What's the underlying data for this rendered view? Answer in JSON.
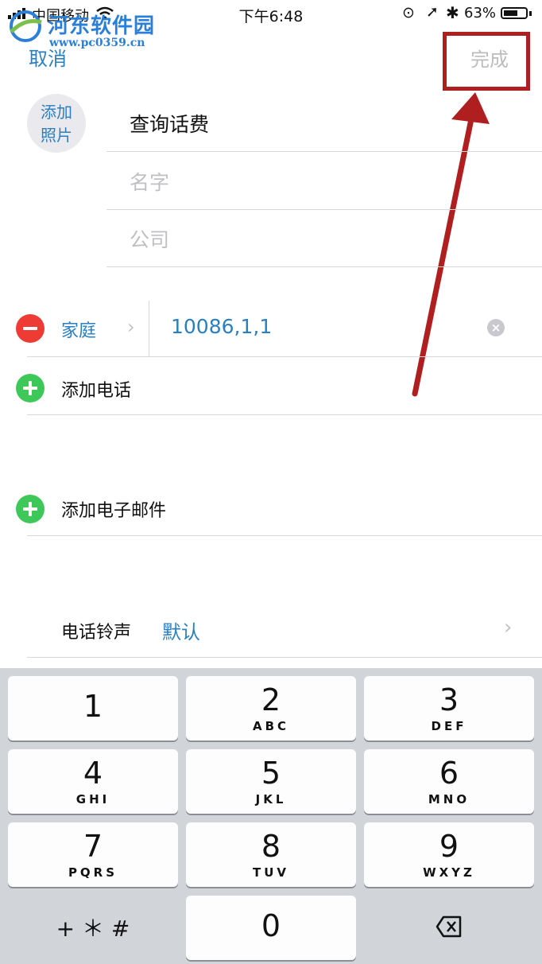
{
  "watermark": {
    "title": "河东软件园",
    "url": "www.pc0359.cn"
  },
  "status_bar": {
    "carrier": "中国移动",
    "time": "下午6:48",
    "battery": "63%"
  },
  "nav": {
    "cancel": "取消",
    "done": "完成"
  },
  "contact": {
    "photo_line1": "添加",
    "photo_line2": "照片",
    "first_field": "查询话费",
    "name_placeholder": "名字",
    "company_placeholder": "公司"
  },
  "phone": {
    "label": "家庭",
    "number": "10086,1,1"
  },
  "add_phone": "添加电话",
  "add_email": "添加电子邮件",
  "ringtone": {
    "label": "电话铃声",
    "value": "默认"
  },
  "keypad": {
    "keys": [
      {
        "num": "1",
        "letters": ""
      },
      {
        "num": "2",
        "letters": "ABC"
      },
      {
        "num": "3",
        "letters": "DEF"
      },
      {
        "num": "4",
        "letters": "GHI"
      },
      {
        "num": "5",
        "letters": "JKL"
      },
      {
        "num": "6",
        "letters": "MNO"
      },
      {
        "num": "7",
        "letters": "PQRS"
      },
      {
        "num": "8",
        "letters": "TUV"
      },
      {
        "num": "9",
        "letters": "WXYZ"
      }
    ],
    "symbols": "+ ＊ #",
    "zero": "0"
  },
  "colors": {
    "accent_blue": "#2a7fc0",
    "annotation_red": "#b01f1f"
  }
}
